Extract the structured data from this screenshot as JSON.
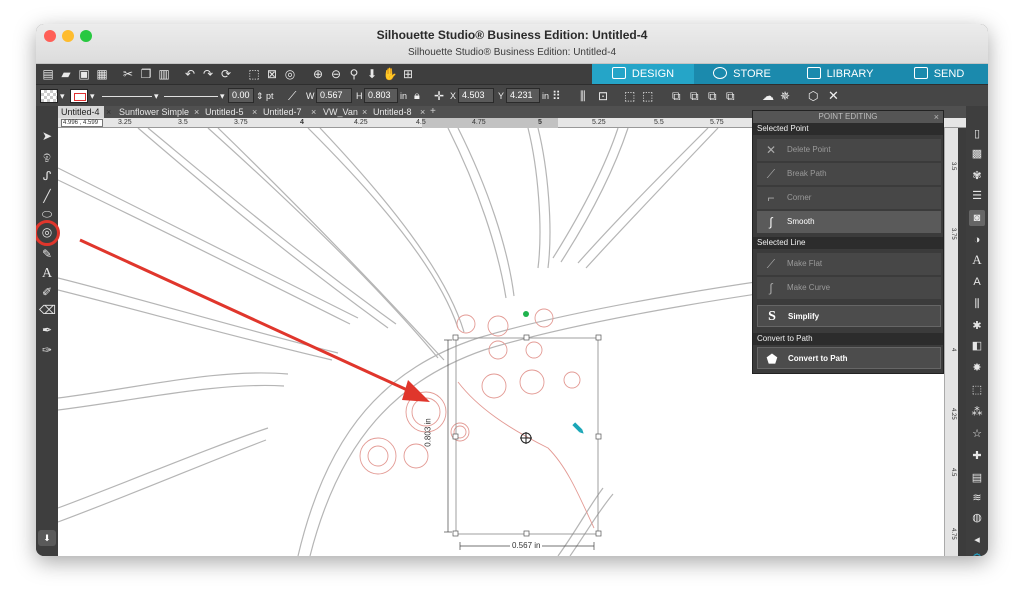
{
  "window": {
    "title": "Silhouette Studio® Business Edition: Untitled-4",
    "subtitle": "Silhouette Studio® Business Edition: Untitled-4"
  },
  "modes": {
    "design": "DESIGN",
    "store": "STORE",
    "library": "LIBRARY",
    "send": "SEND",
    "active_color": "#25a5c8"
  },
  "toolbar": {
    "line_width": "0.00",
    "line_unit": "pt",
    "w_label": "W",
    "w_value": "0.567",
    "h_label": "H",
    "h_value": "0.803",
    "size_unit": "in",
    "x_label": "X",
    "x_value": "4.503",
    "y_label": "Y",
    "y_value": "4.231",
    "pos_unit": "in"
  },
  "tabs": [
    {
      "label": "Untitled-4",
      "active": true
    },
    {
      "label": "Sunflower Simple",
      "active": false
    },
    {
      "label": "Untitled-5",
      "active": false
    },
    {
      "label": "Untitled-7",
      "active": false
    },
    {
      "label": "VW_Van",
      "active": false
    },
    {
      "label": "Untitled-8",
      "active": false
    }
  ],
  "tab_add": "+",
  "ruler": {
    "coords": "4.996 , 4.599",
    "ticks": [
      "3.25",
      "3.5",
      "3.75",
      "4",
      "4.25",
      "4.5",
      "4.75",
      "5",
      "5.25",
      "5.5",
      "5.75"
    ]
  },
  "vruler": {
    "ticks": [
      "3.5",
      "3.75",
      "4",
      "4.25",
      "4.5",
      "4.75"
    ]
  },
  "dimensions": {
    "height": "0.803 in",
    "width": "0.567 in"
  },
  "point_editing": {
    "title": "POINT EDITING",
    "selected_point_header": "Selected Point",
    "delete_point": "Delete Point",
    "break_path": "Break Path",
    "corner": "Corner",
    "smooth": "Smooth",
    "selected_line_header": "Selected Line",
    "make_flat": "Make Flat",
    "make_curve": "Make Curve",
    "simplify": "Simplify",
    "convert_header": "Convert to Path",
    "convert_to_path": "Convert to Path"
  },
  "colors": {
    "annotation": "#e0362c",
    "shape_stroke": "#e39a94",
    "accent": "#25a5c8"
  }
}
